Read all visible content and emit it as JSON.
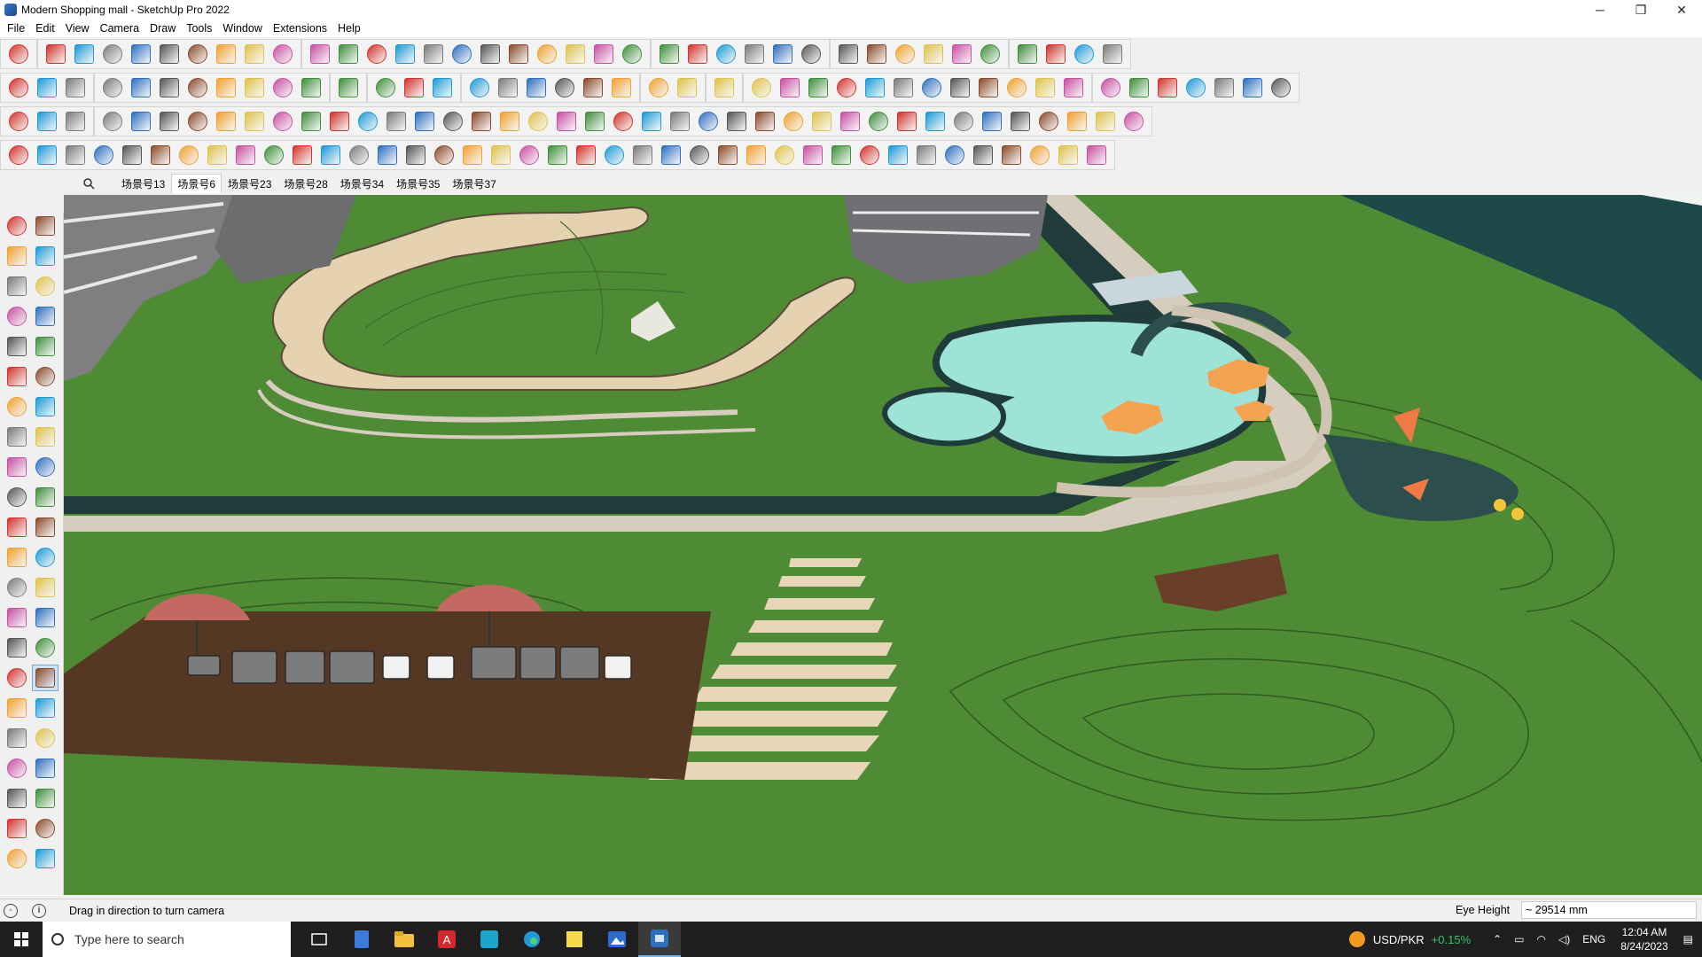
{
  "window": {
    "title": "Modern Shopping mall - SketchUp Pro 2022",
    "controls": {
      "minimize": "─",
      "restore": "❐",
      "close": "✕"
    }
  },
  "menu": [
    "File",
    "Edit",
    "View",
    "Camera",
    "Draw",
    "Tools",
    "Window",
    "Extensions",
    "Help"
  ],
  "scenes": {
    "tabs": [
      "场景号13",
      "场景号6",
      "场景号23",
      "场景号28",
      "场景号34",
      "场景号35",
      "场景号37"
    ],
    "active_index": 1
  },
  "status": {
    "hint": "Drag in direction to turn camera",
    "measure_label": "Eye Height",
    "measure_value": "~ 29514 mm"
  },
  "taskbar": {
    "search_placeholder": "Type here to search",
    "ticker_symbol": "USD/PKR",
    "ticker_change": "+0.15%",
    "language": "ENG",
    "time": "12:04 AM",
    "date": "8/24/2023"
  },
  "colors": {
    "grass": "#4f8a34",
    "plaza": "#9ee3d8",
    "deck": "#5b3a2a",
    "path": "#e7d6b8",
    "water": "#1d4a48"
  }
}
